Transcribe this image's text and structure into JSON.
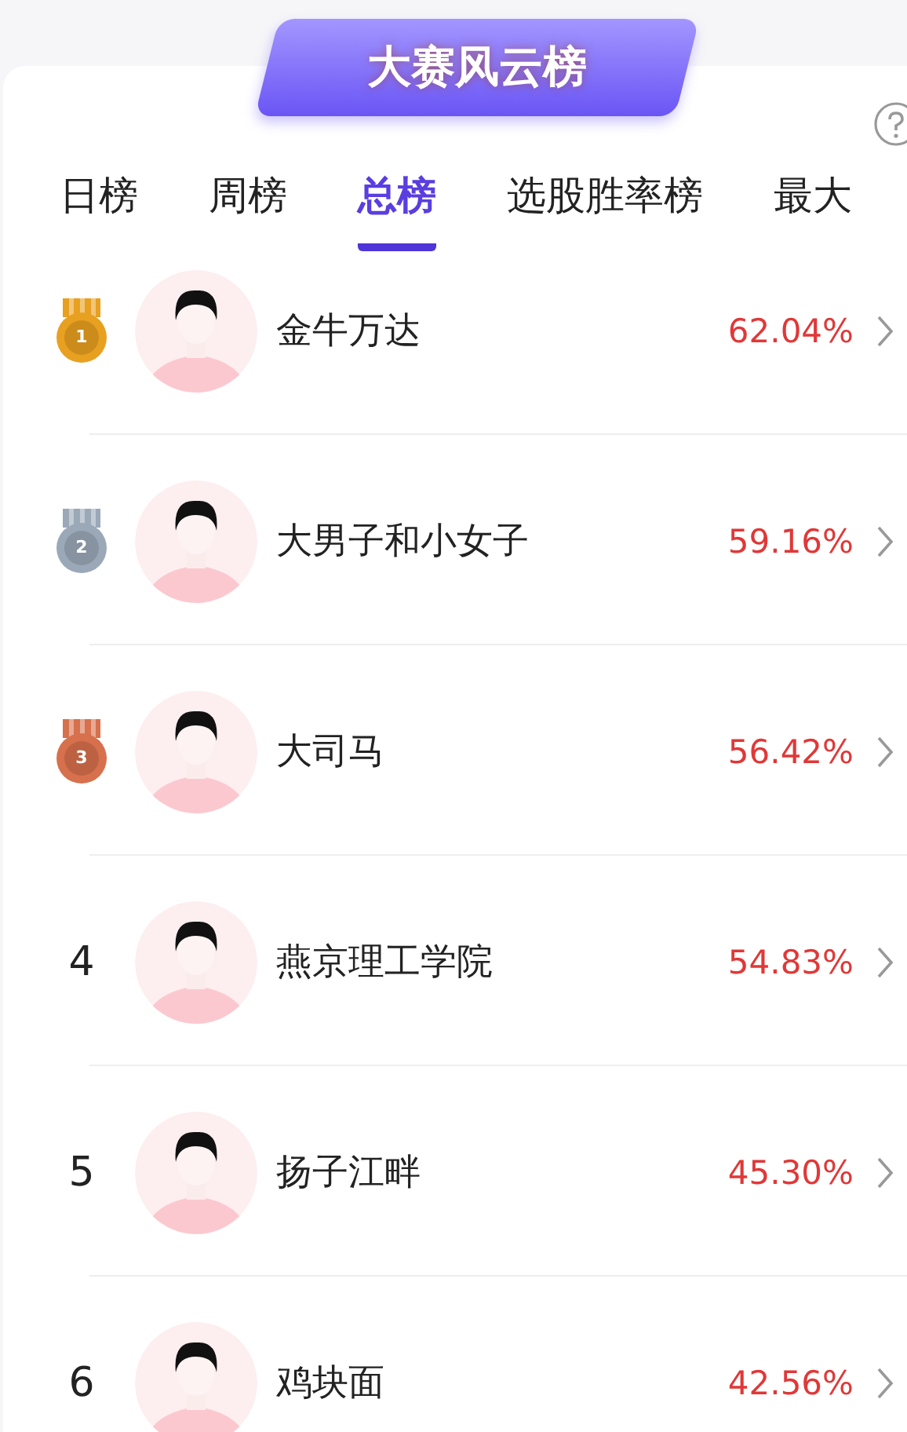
{
  "banner": {
    "title": "大赛风云榜"
  },
  "tabs": [
    {
      "label": "日榜",
      "selected": false
    },
    {
      "label": "周榜",
      "selected": false
    },
    {
      "label": "总榜",
      "selected": true
    },
    {
      "label": "选股胜率榜",
      "selected": false
    },
    {
      "label": "最大",
      "selected": false
    }
  ],
  "ranking": [
    {
      "kind": "medal",
      "rank": "1",
      "color": "#e8a020",
      "name": "金牛万达",
      "rate": "62.04%"
    },
    {
      "kind": "medal",
      "rank": "2",
      "color": "#9aa8b8",
      "name": "大男子和小女子",
      "rate": "59.16%"
    },
    {
      "kind": "medal",
      "rank": "3",
      "color": "#d7704c",
      "name": "大司马",
      "rate": "56.42%"
    },
    {
      "kind": "number",
      "rank": "4",
      "name": "燕京理工学院",
      "rate": "54.83%"
    },
    {
      "kind": "number",
      "rank": "5",
      "name": "扬子江畔",
      "rate": "45.30%"
    },
    {
      "kind": "number",
      "rank": "6",
      "name": "鸡块面",
      "rate": "42.56%"
    }
  ]
}
